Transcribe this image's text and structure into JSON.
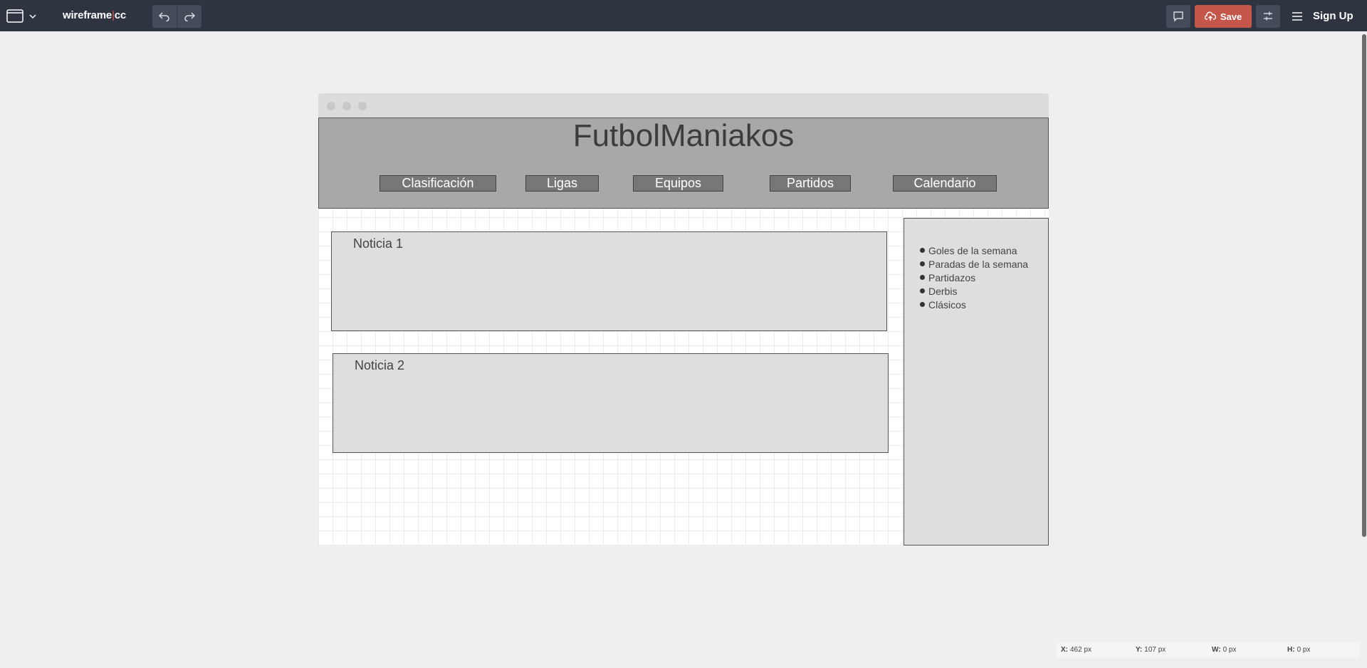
{
  "toolbar": {
    "brand": "wireframe",
    "brand_sep": "|",
    "brand_suffix": "cc",
    "save_label": "Save",
    "signup_label": "Sign Up"
  },
  "wireframe": {
    "site_title": "FutbolManiakos",
    "nav": [
      "Clasificación",
      "Ligas",
      "Equipos",
      "Partidos",
      "Calendario"
    ],
    "news": [
      {
        "title": "Noticia 1"
      },
      {
        "title": "Noticia 2"
      }
    ],
    "sidebar_items": [
      "Goles de la semana",
      "Paradas de la semana",
      "Partidazos",
      "Derbis",
      "Clásicos"
    ]
  },
  "status": {
    "x_label": "X:",
    "x_value": "462 px",
    "y_label": "Y:",
    "y_value": "107 px",
    "w_label": "W:",
    "w_value": "0 px",
    "h_label": "H:",
    "h_value": "0 px"
  },
  "colors": {
    "toolbar_bg": "#2e3440",
    "save_accent": "#c4574a",
    "header_bg": "#a8a8a8",
    "nav_bg": "#777777",
    "panel_bg": "#dedede"
  }
}
